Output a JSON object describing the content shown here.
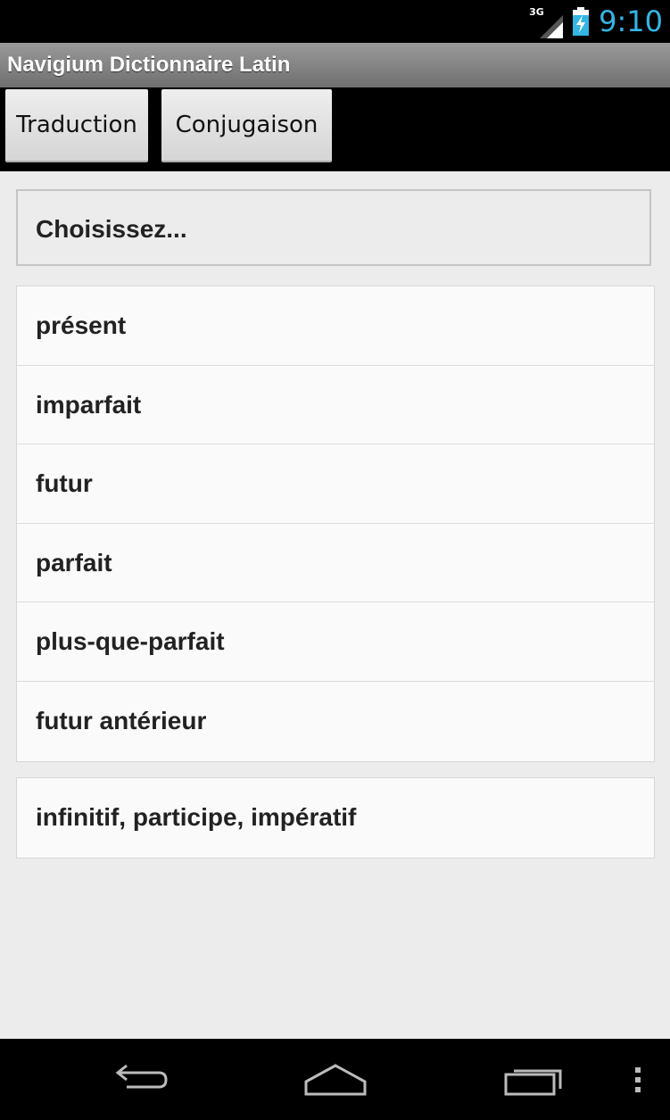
{
  "status_bar": {
    "network": "3G",
    "time": "9:10",
    "icons": [
      "signal-icon",
      "battery-charging-icon"
    ],
    "clock_color": "#33b5e5"
  },
  "app": {
    "title": "Navigium Dictionnaire Latin"
  },
  "tabs": [
    {
      "label": "Traduction"
    },
    {
      "label": "Conjugaison"
    }
  ],
  "selector": {
    "label": "Choisissez..."
  },
  "tenses": [
    {
      "label": "présent"
    },
    {
      "label": "imparfait"
    },
    {
      "label": "futur"
    },
    {
      "label": "parfait"
    },
    {
      "label": "plus-que-parfait"
    },
    {
      "label": "futur antérieur"
    }
  ],
  "other_forms": [
    {
      "label": "infinitif, participe, impératif"
    }
  ],
  "nav_bar": {
    "icons": [
      "back-icon",
      "home-icon",
      "recent-apps-icon",
      "overflow-menu-icon"
    ]
  }
}
